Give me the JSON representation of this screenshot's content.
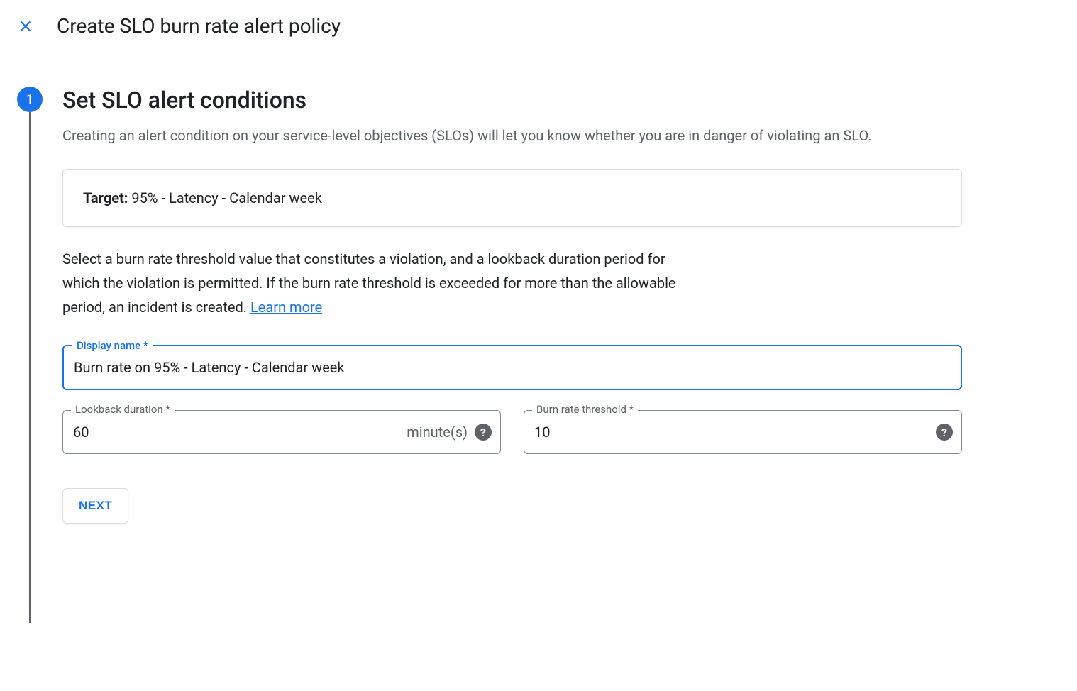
{
  "header": {
    "title": "Create SLO burn rate alert policy"
  },
  "step": {
    "number": "1",
    "title": "Set SLO alert conditions",
    "description": "Creating an alert condition on your service-level objectives (SLOs) will let you know whether you are in danger of violating an SLO.",
    "target_label": "Target:",
    "target_value": " 95% - Latency - Calendar week",
    "instruction": "Select a burn rate threshold value that constitutes a violation, and a lookback duration period for which the violation is permitted. If the burn rate threshold is exceeded for more than the allowable period, an incident is created. ",
    "learn_more": "Learn more",
    "fields": {
      "display_name": {
        "label": "Display name *",
        "value": "Burn rate on 95% - Latency - Calendar week"
      },
      "lookback": {
        "label": "Lookback duration *",
        "value": "60",
        "suffix": "minute(s)"
      },
      "threshold": {
        "label": "Burn rate threshold *",
        "value": "10"
      }
    },
    "next_button": "NEXT"
  }
}
